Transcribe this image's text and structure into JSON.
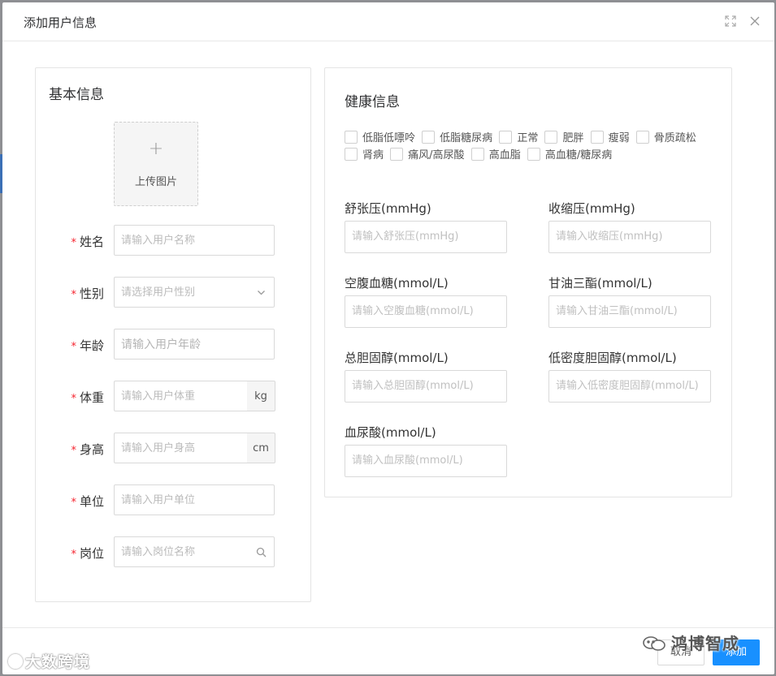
{
  "dialog": {
    "title": "添加用户信息"
  },
  "basic": {
    "title": "基本信息",
    "upload_plus": "+",
    "upload_label": "上传图片",
    "fields": [
      {
        "label": "姓名",
        "placeholder": "请输入用户名称"
      },
      {
        "label": "性别",
        "placeholder": "请选择用户性别"
      },
      {
        "label": "年龄",
        "placeholder": "请输入用户年龄"
      },
      {
        "label": "体重",
        "placeholder": "请输入用户体重",
        "addon": "kg"
      },
      {
        "label": "身高",
        "placeholder": "请输入用户身高",
        "addon": "cm"
      },
      {
        "label": "单位",
        "placeholder": "请输入用户单位"
      },
      {
        "label": "岗位",
        "placeholder": "请输入岗位名称"
      }
    ],
    "required_mark": "*"
  },
  "health": {
    "title": "健康信息",
    "conditions_row1": [
      "低脂低嘌呤",
      "低脂糖尿病",
      "正常",
      "肥胖",
      "瘦弱",
      "骨质疏松"
    ],
    "conditions_row2": [
      "肾病",
      "痛风/高尿酸",
      "高血脂",
      "高血糖/糖尿病"
    ],
    "fields": [
      {
        "label": "舒张压(mmHg)",
        "placeholder": "请输入舒张压(mmHg)"
      },
      {
        "label": "收缩压(mmHg)",
        "placeholder": "请输入收缩压(mmHg)"
      },
      {
        "label": "空腹血糖(mmol/L)",
        "placeholder": "请输入空腹血糖(mmol/L)"
      },
      {
        "label": "甘油三酯(mmol/L)",
        "placeholder": "请输入甘油三酯(mmol/L)"
      },
      {
        "label": "总胆固醇(mmol/L)",
        "placeholder": "请输入总胆固醇(mmol/L)"
      },
      {
        "label": "低密度胆固醇(mmol/L)",
        "placeholder": "请输入低密度胆固醇(mmol/L)"
      },
      {
        "label": "血尿酸(mmol/L)",
        "placeholder": "请输入血尿酸(mmol/L)"
      }
    ]
  },
  "footer": {
    "cancel_label": "取消",
    "add_label": "添加"
  },
  "watermarks": {
    "left": "大数跨境",
    "right": "鸿博智成"
  },
  "icons": {
    "maximize": "maximize-icon",
    "close": "close-icon",
    "chevron": "chevron-down-icon",
    "search": "search-icon",
    "wechat": "wechat-icon"
  },
  "colors": {
    "primary": "#1890ff",
    "required": "#f5222d"
  }
}
